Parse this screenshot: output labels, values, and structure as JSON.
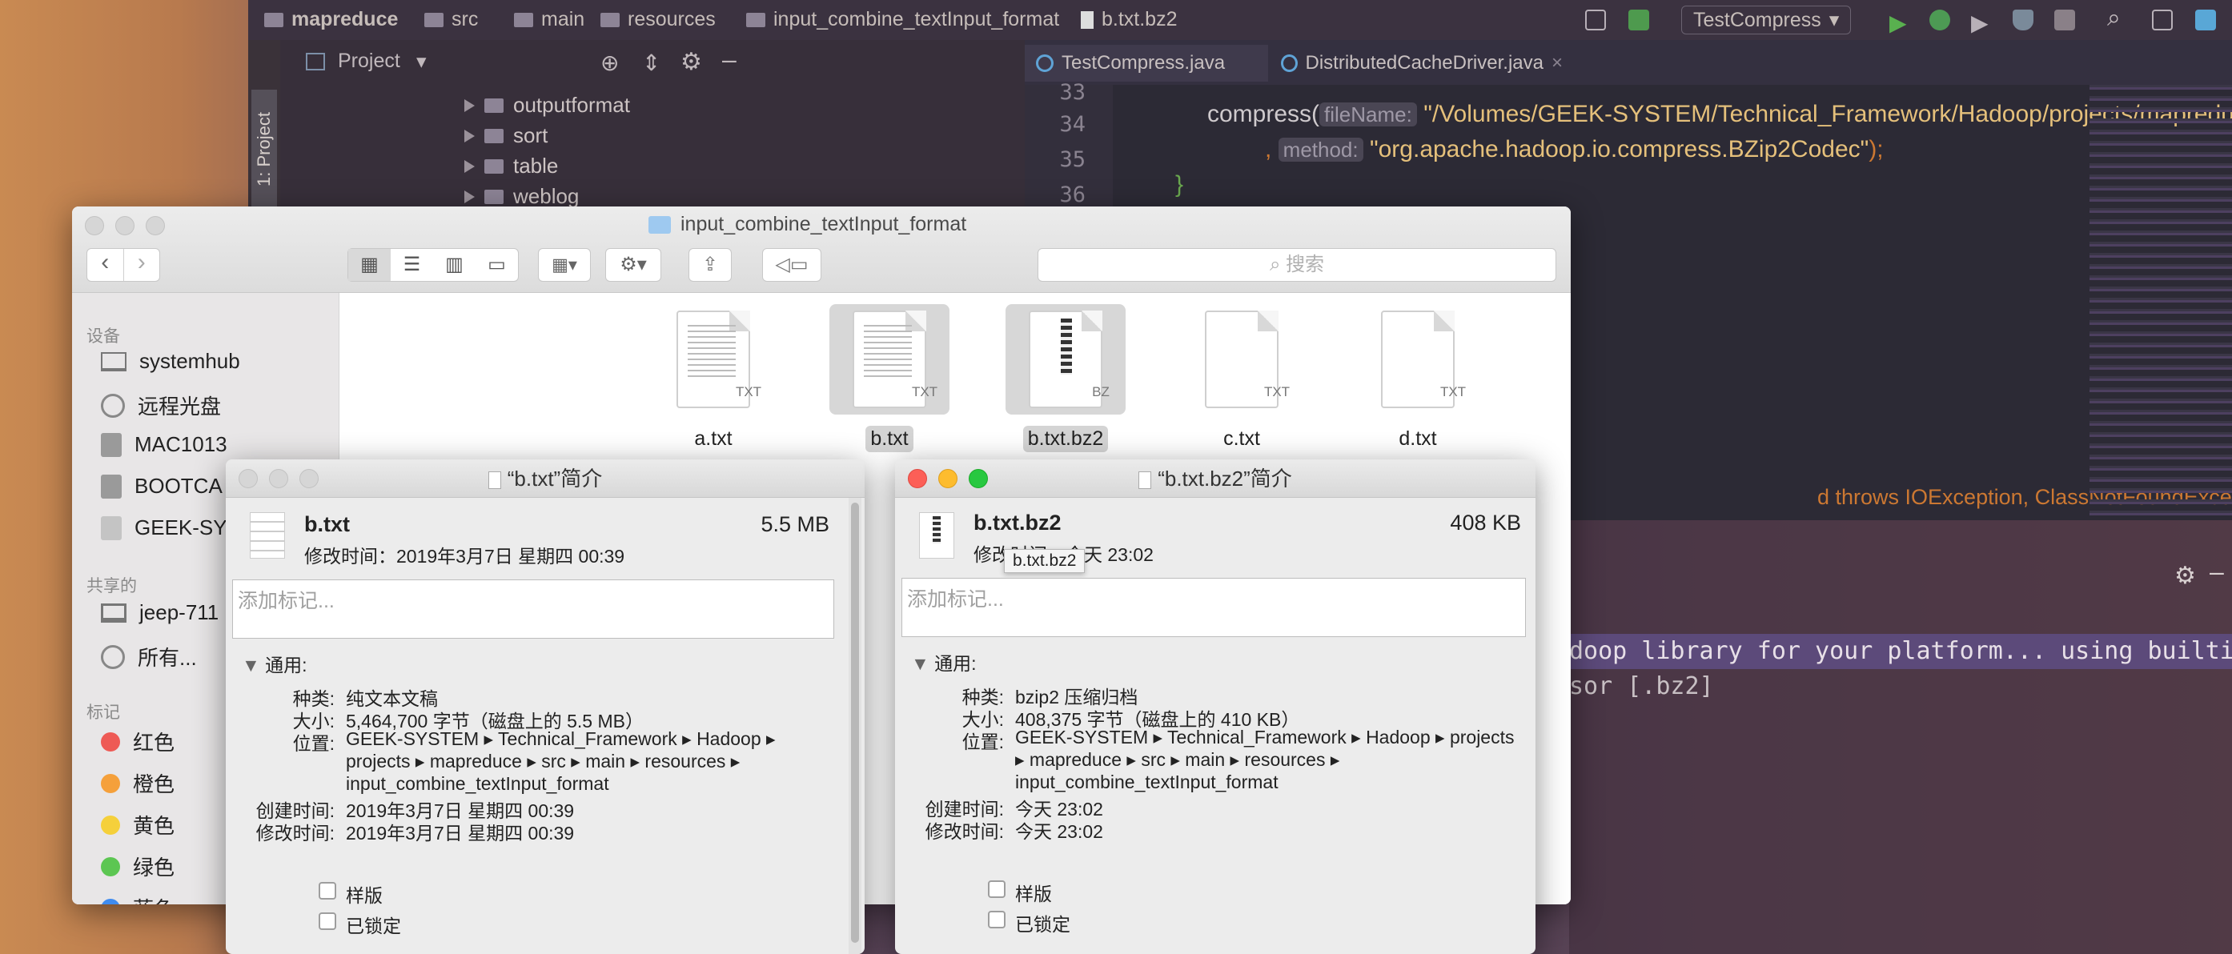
{
  "ide": {
    "breadcrumbs": [
      "mapreduce",
      "src",
      "main",
      "resources",
      "input_combine_textInput_format",
      "b.txt.bz2"
    ],
    "run_config": "TestCompress",
    "side_tab": "1: Project",
    "project_label": "Project",
    "tree": [
      "outputformat",
      "sort",
      "table",
      "weblog"
    ],
    "tabs": [
      "TestCompress.java",
      "DistributedCacheDriver.java"
    ],
    "lines": [
      {
        "n": "34",
        "pre": "compress(",
        "hint": "fileName:",
        "str": "\"/Volumes/GEEK-SYSTEM/Technical_Framework/Hadoop/projects/mapreduce/"
      },
      {
        "n": "35",
        "pre": ", ",
        "hint": "method:",
        "str": "\"org.apache.hadoop.io.compress.BZip2Codec\"",
        "post": ");"
      },
      {
        "n": "36",
        "pre": "}"
      }
    ],
    "line33": "33",
    "throws_text": "d  throws IOException, ClassNotFoundExceptio",
    "console": [
      "doop library for your platform... using builtin-java classes w",
      "sor [.bz2]"
    ]
  },
  "finder": {
    "title": "input_combine_textInput_format",
    "search_placeholder": "搜索",
    "sidebar": {
      "devices_h": "设备",
      "devices": [
        "systemhub",
        "远程光盘",
        "MAC1013",
        "BOOTCA",
        "GEEK-SY"
      ],
      "shared_h": "共享的",
      "shared": [
        "jeep-711",
        "所有..."
      ],
      "tags_h": "标记",
      "tags": [
        {
          "label": "红色",
          "color": "#ee5a55"
        },
        {
          "label": "橙色",
          "color": "#f5a03b"
        },
        {
          "label": "黄色",
          "color": "#f5d03b"
        },
        {
          "label": "绿色",
          "color": "#5cc652"
        },
        {
          "label": "蓝色",
          "color": "#3f8cf0"
        }
      ]
    },
    "files": [
      {
        "name": "a.txt",
        "ext": "TXT"
      },
      {
        "name": "b.txt",
        "ext": "TXT"
      },
      {
        "name": "b.txt.bz2",
        "ext": "BZ"
      },
      {
        "name": "c.txt",
        "ext": "TXT"
      },
      {
        "name": "d.txt",
        "ext": "TXT"
      }
    ]
  },
  "info_b": {
    "title": "“b.txt”简介",
    "name": "b.txt",
    "size": "5.5 MB",
    "modified_line": "修改时间：2019年3月7日 星期四 00:39",
    "tag_placeholder": "添加标记...",
    "section": "通用:",
    "kind_l": "种类:",
    "kind": "纯文本文稿",
    "size_l": "大小:",
    "size_full": "5,464,700 字节（磁盘上的 5.5 MB）",
    "where_l": "位置:",
    "where": [
      "GEEK-SYSTEM ▸ Technical_Framework ▸ Hadoop ▸",
      "projects ▸ mapreduce ▸ src ▸ main ▸ resources ▸",
      "input_combine_textInput_format"
    ],
    "created_l": "创建时间:",
    "created": "2019年3月7日 星期四 00:39",
    "mod_l": "修改时间:",
    "mod": "2019年3月7日 星期四 00:39",
    "stationery": "样版",
    "locked": "已锁定"
  },
  "info_bz": {
    "title": "“b.txt.bz2”简介",
    "name": "b.txt.bz2",
    "size": "408 KB",
    "modified_line": "修改时间：今天 23:02",
    "tooltip": "b.txt.bz2",
    "tag_placeholder": "添加标记...",
    "section": "通用:",
    "kind_l": "种类:",
    "kind": "bzip2 压缩归档",
    "size_l": "大小:",
    "size_full": "408,375 字节（磁盘上的 410 KB）",
    "where_l": "位置:",
    "where": [
      "GEEK-SYSTEM ▸ Technical_Framework ▸ Hadoop ▸ projects",
      "▸ mapreduce ▸ src ▸ main ▸ resources ▸",
      "input_combine_textInput_format"
    ],
    "created_l": "创建时间:",
    "created": "今天 23:02",
    "mod_l": "修改时间:",
    "mod": "今天 23:02",
    "stationery": "样版",
    "locked": "已锁定"
  }
}
